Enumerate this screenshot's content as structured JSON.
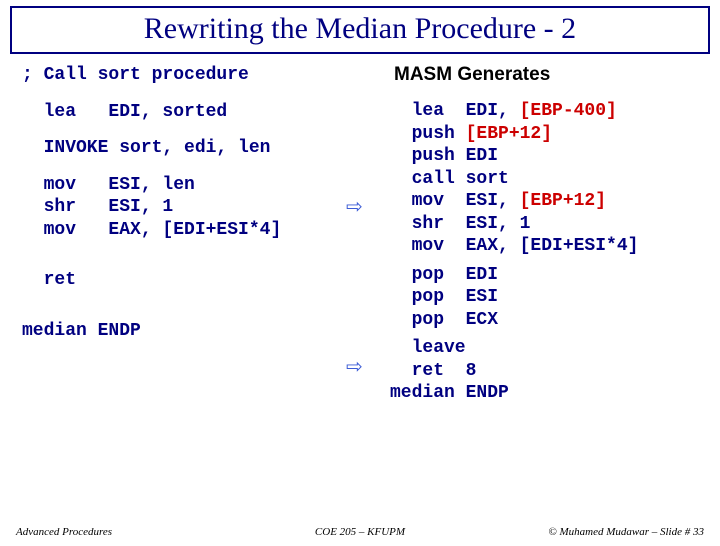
{
  "title": "Rewriting the Median Procedure - 2",
  "left": {
    "comment": "; Call sort procedure",
    "l1": "  lea   EDI, sorted",
    "l2": "  INVOKE sort, edi, len",
    "l3": "  mov   ESI, len\n  shr   ESI, 1\n  mov   EAX, [EDI+ESI*4]",
    "l4": "  ret",
    "l5": "median ENDP"
  },
  "right": {
    "header": "MASM Generates",
    "r1a": "  lea  EDI, ",
    "r1b": "[EBP-400]",
    "r2a": "  push ",
    "r2b": "[EBP+12]",
    "r3": "  push EDI\n  call sort",
    "r4a": "  mov  ESI, ",
    "r4b": "[EBP+12]",
    "r5": "  shr  ESI, 1\n  mov  EAX, [EDI+ESI*4]",
    "r6": "  pop  EDI\n  pop  ESI\n  pop  ECX",
    "r7": "  leave\n  ret  8",
    "r8": "median ENDP"
  },
  "footer": {
    "left": "Advanced Procedures",
    "center": "COE 205 – KFUPM",
    "right": "© Muhamed Mudawar – Slide # 33"
  }
}
